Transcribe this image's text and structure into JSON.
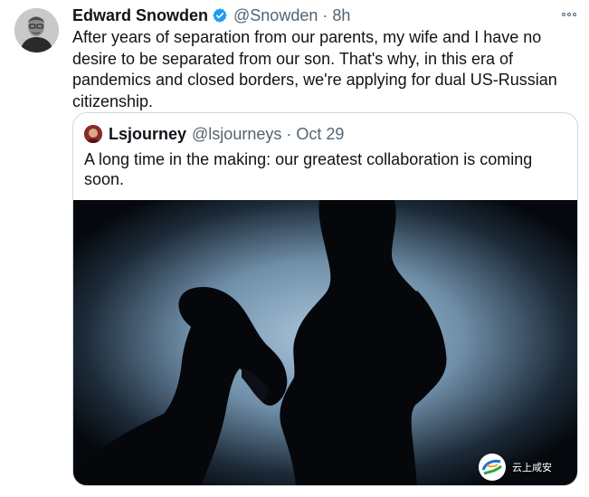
{
  "tweet": {
    "author_name": "Edward Snowden",
    "author_handle": "@Snowden",
    "separator": "·",
    "time": "8h",
    "text": "After years of separation from our parents, my wife and I have no desire to be separated from our son. That's why, in this era of pandemics and closed borders, we're applying for dual US-Russian citizenship.",
    "icons": {
      "avatar": "avatar-photo",
      "verified": "verified-badge-icon",
      "more": "more-options-icon"
    }
  },
  "quoted_tweet": {
    "author_name": "Lsjourney",
    "author_handle": "@lsjourneys",
    "separator": "·",
    "date": "Oct 29",
    "text": "A long time in the making: our greatest collaboration is coming soon.",
    "image_watermark": "云上咸安"
  },
  "colors": {
    "text_primary": "#0f1419",
    "text_secondary": "#536471",
    "verified_blue": "#1d9bf0",
    "border": "#cfd9de",
    "photo_backlight": "#8fb2cc"
  }
}
